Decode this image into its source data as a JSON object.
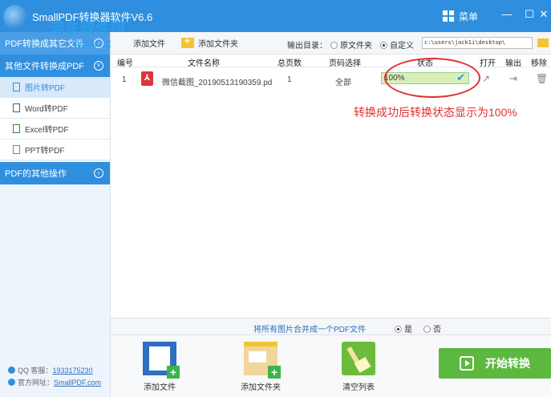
{
  "window": {
    "title": "SmallPDF转换器软件V6.6",
    "menu_label": "菜单",
    "minimize": "—",
    "maximize": "☐",
    "close": "✕"
  },
  "watermark": {
    "line1": "河东软件园",
    "line2": "www.pc0359.cn"
  },
  "sidebar": {
    "section1": "PDF转换成其它文件",
    "section2": "其他文件转换成PDF",
    "items": [
      {
        "label": "图片转PDF",
        "icon": "image-file-icon",
        "active": true
      },
      {
        "label": "Word转PDF",
        "icon": "word-file-icon",
        "active": false
      },
      {
        "label": "Excel转PDF",
        "icon": "excel-file-icon",
        "active": false
      },
      {
        "label": "PPT转PDF",
        "icon": "ppt-file-icon",
        "active": false
      }
    ],
    "section3": "PDF的其他操作",
    "support_label": "QQ 客服：",
    "support_qq": "1933175230",
    "site_label": "官方网址：",
    "site": "SmallPDF.com"
  },
  "toolbar": {
    "add_file": "添加文件",
    "add_folder": "添加文件夹",
    "output_label": "输出目录：",
    "opt_source": "原文件夹",
    "opt_custom": "自定义",
    "output_path": "c:\\users\\jack1i\\desktop\\"
  },
  "table": {
    "headers": [
      "编号",
      "文件名称",
      "总页数",
      "页码选择",
      "状态",
      "打开",
      "输出",
      "移除"
    ],
    "rows": [
      {
        "index": "1",
        "filename": "微信截图_20190513190359.pd",
        "pages": "1",
        "page_select": "全部",
        "status": "100%",
        "progress": 1.0
      }
    ]
  },
  "annotation": "转换成功后转换状态显示为100%",
  "merge": {
    "label": "将所有图片合并成一个PDF文件",
    "yes": "是",
    "no": "否"
  },
  "bottom": {
    "add_file": "添加文件",
    "add_folder": "添加文件夹",
    "clear_list": "清空列表",
    "start": "开始转换"
  },
  "colors": {
    "brand": "#2f8fde",
    "start_button": "#5cb83f",
    "annotation": "#e03030"
  }
}
